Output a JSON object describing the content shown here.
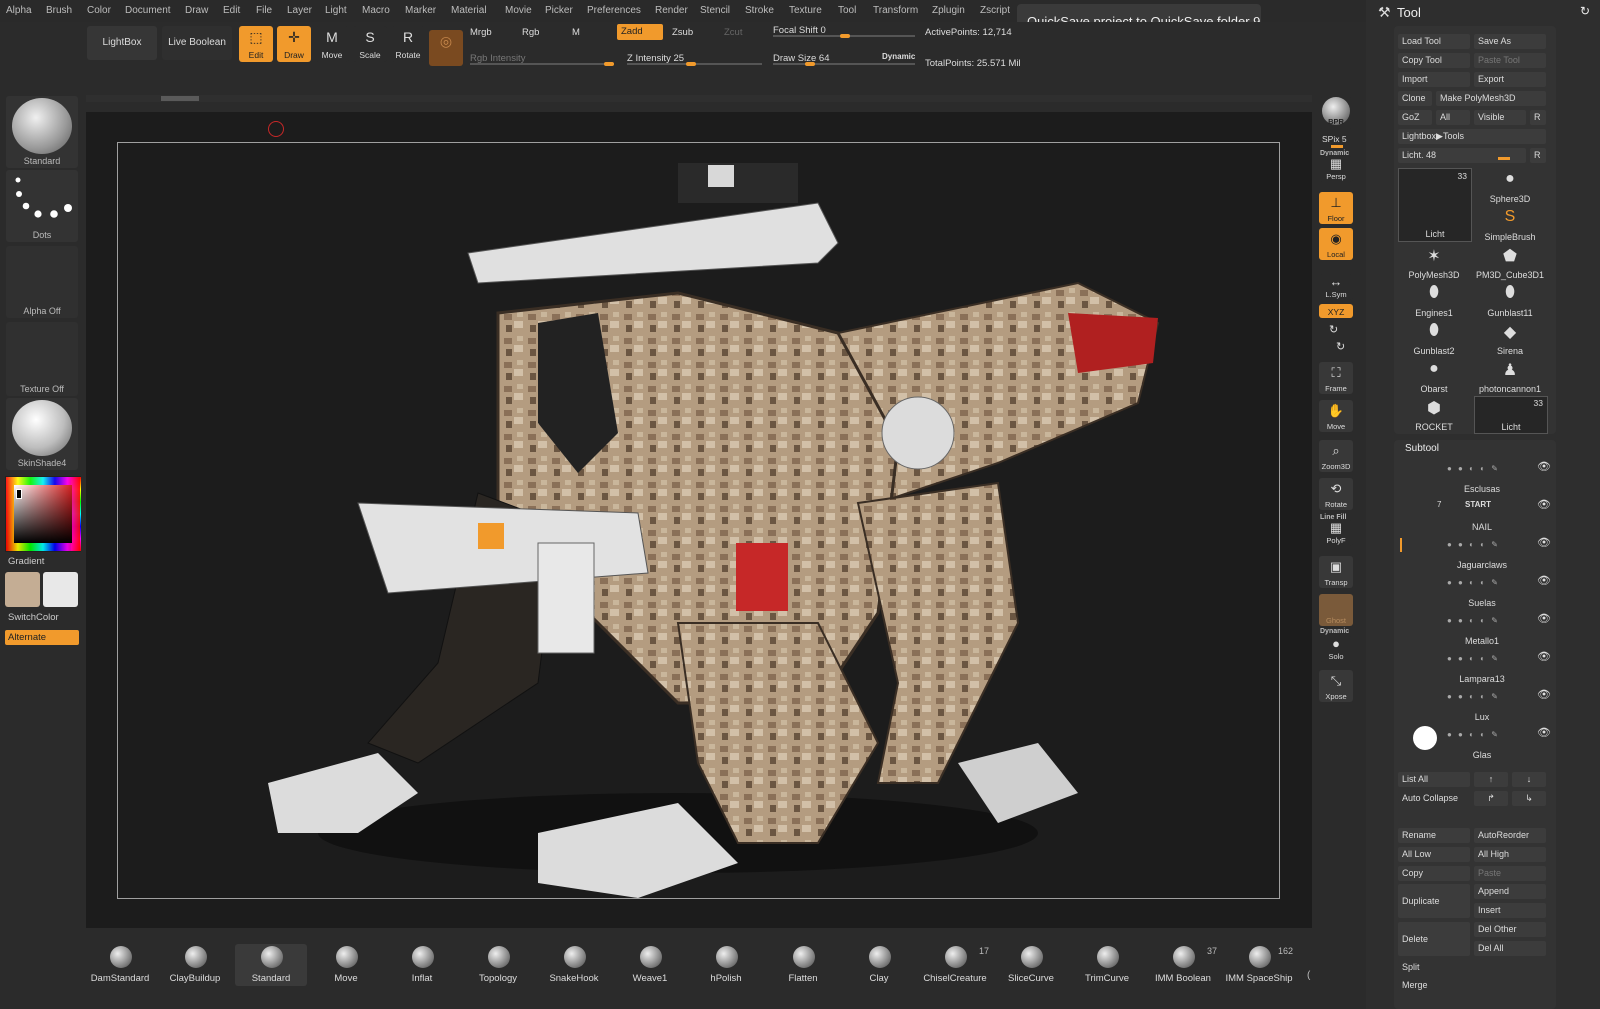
{
  "menu": [
    "Alpha",
    "Brush",
    "Color",
    "Document",
    "Draw",
    "Edit",
    "File",
    "Layer",
    "Light",
    "Macro",
    "Marker",
    "Material",
    "Movie",
    "Picker",
    "Preferences",
    "Render",
    "Stencil",
    "Stroke",
    "Texture",
    "Tool",
    "Transform",
    "Zplugin",
    "Zscript"
  ],
  "tooltip": "QuickSave project to QuickSave folder  9",
  "toolbar": {
    "lightbox": "LightBox",
    "live_boolean": "Live Boolean",
    "edit": "Edit",
    "draw": "Draw",
    "move": "Move",
    "scale": "Scale",
    "rotate": "Rotate",
    "mrgb": "Mrgb",
    "rgb": "Rgb",
    "m": "M",
    "zadd": "Zadd",
    "zsub": "Zsub",
    "zcut": "Zcut",
    "rgb_intensity": "Rgb Intensity",
    "z_intensity": "Z Intensity 25",
    "focal_shift": "Focal Shift 0",
    "draw_size": "Draw Size 64",
    "dynamic": "Dynamic",
    "active_points": "ActivePoints: 12,714",
    "total_points": "TotalPoints: 25.571 Mil"
  },
  "left_shelf": {
    "brush": "Standard",
    "stroke": "Dots",
    "alpha": "Alpha Off",
    "texture": "Texture Off",
    "material": "SkinShade4",
    "gradient": "Gradient",
    "switch_color": "SwitchColor",
    "alternate": "Alternate",
    "main_color": "#c4ad94",
    "secondary_color": "#e8e8e8"
  },
  "right_shelf": {
    "bpr": "BPR",
    "spix": "SPix 5",
    "dynamic": "Dynamic",
    "persp": "Persp",
    "floor": "Floor",
    "local": "Local",
    "lsym": "L.Sym",
    "xyz": "XYZ",
    "frame": "Frame",
    "move": "Move",
    "zoom3d": "Zoom3D",
    "rotate": "Rotate",
    "line_fill": "Line Fill",
    "polyf": "PolyF",
    "transp": "Transp",
    "ghost": "Ghost",
    "dynamic2": "Dynamic",
    "solo": "Solo",
    "xpose": "Xpose"
  },
  "tool_panel": {
    "title": "Tool",
    "buttons": {
      "load_tool": "Load Tool",
      "save_as": "Save As",
      "copy_tool": "Copy Tool",
      "paste_tool": "Paste Tool",
      "import": "Import",
      "export": "Export",
      "clone": "Clone",
      "make_polymesh": "Make PolyMesh3D",
      "goz": "GoZ",
      "all": "All",
      "visible": "Visible",
      "r": "R",
      "lightbox_tools": "Lightbox▶Tools",
      "licht_slider": "Licht. 48",
      "r2": "R"
    },
    "tools": [
      {
        "name": "Licht",
        "count": "33"
      },
      {
        "name": "Sphere3D",
        "count": ""
      },
      {
        "name": "SimpleBrush",
        "count": ""
      },
      {
        "name": "PolyMesh3D",
        "count": ""
      },
      {
        "name": "PM3D_Cube3D1",
        "count": ""
      },
      {
        "name": "Engines1",
        "count": ""
      },
      {
        "name": "Gunblast11",
        "count": ""
      },
      {
        "name": "Gunblast2",
        "count": ""
      },
      {
        "name": "Sirena",
        "count": ""
      },
      {
        "name": "Obarst",
        "count": ""
      },
      {
        "name": "photoncannon1",
        "count": ""
      },
      {
        "name": "ROCKET",
        "count": ""
      },
      {
        "name": "Licht",
        "count": "33"
      }
    ],
    "subtool_title": "Subtool",
    "subtools": [
      "Esclusas",
      "START",
      "NAIL",
      "Jaguarclaws",
      "Suelas",
      "Metallo1",
      "Lampara13",
      "Lux",
      "Glas"
    ],
    "start_count": "7",
    "list_all": "List All",
    "auto_collapse": "Auto Collapse",
    "rename": "Rename",
    "auto_reorder": "AutoReorder",
    "all_low": "All Low",
    "all_high": "All High",
    "copy": "Copy",
    "paste": "Paste",
    "append": "Append",
    "duplicate": "Duplicate",
    "insert": "Insert",
    "del_other": "Del Other",
    "delete": "Delete",
    "del_all": "Del All",
    "split": "Split",
    "merge": "Merge"
  },
  "brushes": [
    {
      "name": "DamStandard",
      "count": ""
    },
    {
      "name": "ClayBuildup",
      "count": ""
    },
    {
      "name": "Standard",
      "count": ""
    },
    {
      "name": "Move",
      "count": ""
    },
    {
      "name": "Inflat",
      "count": ""
    },
    {
      "name": "Topology",
      "count": ""
    },
    {
      "name": "SnakeHook",
      "count": ""
    },
    {
      "name": "Weave1",
      "count": ""
    },
    {
      "name": "hPolish",
      "count": ""
    },
    {
      "name": "Flatten",
      "count": ""
    },
    {
      "name": "Clay",
      "count": ""
    },
    {
      "name": "ChiselCreature",
      "count": "17"
    },
    {
      "name": "SliceCurve",
      "count": ""
    },
    {
      "name": "TrimCurve",
      "count": ""
    },
    {
      "name": "IMM Boolean",
      "count": "37"
    },
    {
      "name": "IMM SpaceShip",
      "count": "162"
    }
  ],
  "colors": {
    "accent": "#f19a2c",
    "bg": "#2b2b2b",
    "canvas": "#1c1c1c"
  }
}
